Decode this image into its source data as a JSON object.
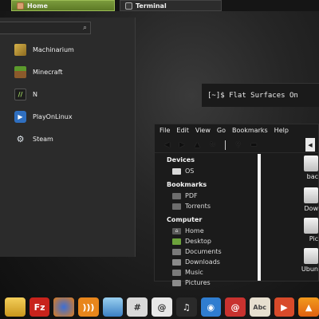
{
  "taskbar": {
    "tasks": [
      {
        "label": "Home",
        "icon": "folder-home-icon",
        "active": true
      },
      {
        "label": "Terminal",
        "icon": "terminal-icon",
        "active": false
      }
    ]
  },
  "app_menu": {
    "search": {
      "placeholder": "",
      "icon": "search-icon"
    },
    "items": [
      {
        "label": "Machinarium",
        "icon": "machinarium-icon"
      },
      {
        "label": "Minecraft",
        "icon": "minecraft-icon"
      },
      {
        "label": "N",
        "icon": "n-game-icon"
      },
      {
        "label": "PlayOnLinux",
        "icon": "playonlinux-icon"
      },
      {
        "label": "Steam",
        "icon": "steam-icon"
      }
    ]
  },
  "terminal": {
    "text": "[~]$ Flat Surfaces On"
  },
  "file_manager": {
    "menubar": [
      "File",
      "Edit",
      "View",
      "Go",
      "Bookmarks",
      "Help"
    ],
    "sections": {
      "devices": {
        "title": "Devices",
        "items": [
          {
            "label": "OS",
            "icon": "drive-icon"
          }
        ]
      },
      "bookmarks": {
        "title": "Bookmarks",
        "items": [
          {
            "label": "PDF",
            "icon": "folder-icon"
          },
          {
            "label": "Torrents",
            "icon": "folder-icon"
          }
        ]
      },
      "computer": {
        "title": "Computer",
        "items": [
          {
            "label": "Home",
            "icon": "home-icon"
          },
          {
            "label": "Desktop",
            "icon": "desktop-icon"
          },
          {
            "label": "Documents",
            "icon": "documents-icon"
          },
          {
            "label": "Downloads",
            "icon": "downloads-icon"
          },
          {
            "label": "Music",
            "icon": "music-icon"
          },
          {
            "label": "Pictures",
            "icon": "pictures-icon"
          }
        ]
      }
    },
    "files": [
      "bac",
      "Dow",
      "Pic",
      "Ubun"
    ]
  },
  "dock": {
    "icons": [
      "folder-icon",
      "filezilla-icon",
      "firefox-icon",
      "rss-icon",
      "image-viewer-icon",
      "calculator-icon",
      "amarok-icon",
      "headphones-icon",
      "network-icon",
      "mail-icon",
      "text-editor-icon",
      "media-player-icon",
      "vlc-icon"
    ]
  },
  "colors": {
    "accent": "#7a9a3c",
    "background": "#1c1c1c"
  }
}
